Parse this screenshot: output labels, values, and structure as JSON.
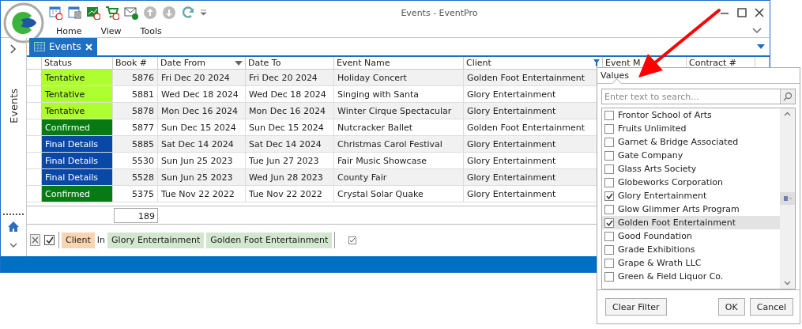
{
  "window": {
    "title": "Events - EventPro",
    "ribbon_tabs": [
      "Home",
      "View",
      "Tools"
    ]
  },
  "nav": {
    "label": "Events"
  },
  "document_tabs": [
    {
      "label": "Events",
      "selected": true
    }
  ],
  "table": {
    "columns": [
      {
        "label": "Status",
        "sorted": false,
        "filtered": false
      },
      {
        "label": "Book #",
        "sorted": false,
        "filtered": false
      },
      {
        "label": "Date From",
        "sorted": true,
        "filtered": false
      },
      {
        "label": "Date To",
        "sorted": false,
        "filtered": false
      },
      {
        "label": "Event Name",
        "sorted": false,
        "filtered": false
      },
      {
        "label": "Client",
        "sorted": false,
        "filtered": true
      },
      {
        "label": "Event M",
        "sorted": false,
        "filtered": false
      },
      {
        "label": "Contract #",
        "sorted": false,
        "filtered": false
      }
    ],
    "rows": [
      {
        "status": "Tentative",
        "color": "#adff2f",
        "book": "5876",
        "date_from": "Fri Dec 20 2024",
        "date_to": "Fri Dec 20 2024",
        "event_name": "Holiday Concert",
        "client": "Golden Foot Entertainment"
      },
      {
        "status": "Tentative",
        "color": "#adff2f",
        "book": "5881",
        "date_from": "Wed Dec 18 2024",
        "date_to": "Wed Dec 18 2024",
        "event_name": "Singing with Santa",
        "client": "Glory Entertainment"
      },
      {
        "status": "Tentative",
        "color": "#adff2f",
        "book": "5878",
        "date_from": "Mon Dec 16 2024",
        "date_to": "Mon Dec 16 2024",
        "event_name": "Winter Cirque Spectacular",
        "client": "Glory Entertainment"
      },
      {
        "status": "Confirmed",
        "color": "#087a14",
        "book": "5877",
        "date_from": "Sun Dec 15 2024",
        "date_to": "Sun Dec 15 2024",
        "event_name": "Nutcracker Ballet",
        "client": "Golden Foot Entertainment"
      },
      {
        "status": "Final Details",
        "color": "#0a48a8",
        "book": "5885",
        "date_from": "Sat Dec 14 2024",
        "date_to": "Sat Dec 14 2024",
        "event_name": "Christmas Carol Festival",
        "client": "Glory Entertainment"
      },
      {
        "status": "Final Details",
        "color": "#0a48a8",
        "book": "5530",
        "date_from": "Sun Jun 25 2023",
        "date_to": "Tue Jun 27 2023",
        "event_name": "Fair Music Showcase",
        "client": "Glory Entertainment"
      },
      {
        "status": "Final Details",
        "color": "#0a48a8",
        "book": "5528",
        "date_from": "Sun Jun 25 2023",
        "date_to": "Wed Jun 28 2023",
        "event_name": "County Fair",
        "client": "Glory Entertainment"
      },
      {
        "status": "Confirmed",
        "color": "#087a14",
        "book": "5375",
        "date_from": "Tue Nov 22 2022",
        "date_to": "Tue Nov 22 2022",
        "event_name": "Crystal Solar Quake",
        "client": "Glory Entertainment"
      }
    ],
    "total": "189"
  },
  "filter": {
    "enabled": true,
    "field": "Client",
    "operator": "In",
    "values": [
      "Glory Entertainment",
      "Golden Foot Entertainment"
    ]
  },
  "filter_popup": {
    "tab": "Values",
    "search_placeholder": "Enter text to search...",
    "items": [
      {
        "label": "Frontor School of Arts",
        "checked": false,
        "selected": false
      },
      {
        "label": "Fruits Unlimited",
        "checked": false,
        "selected": false
      },
      {
        "label": "Garnet & Bridge Associated",
        "checked": false,
        "selected": false
      },
      {
        "label": "Gate Company",
        "checked": false,
        "selected": false
      },
      {
        "label": "Glass Arts Society",
        "checked": false,
        "selected": false
      },
      {
        "label": "Globeworks Corporation",
        "checked": false,
        "selected": false
      },
      {
        "label": "Glory Entertainment",
        "checked": true,
        "selected": false
      },
      {
        "label": "Glow Glimmer Arts Program",
        "checked": false,
        "selected": false
      },
      {
        "label": "Golden Foot Entertainment",
        "checked": true,
        "selected": true
      },
      {
        "label": "Good Foundation",
        "checked": false,
        "selected": false
      },
      {
        "label": "Grade Exhibitions",
        "checked": false,
        "selected": false
      },
      {
        "label": "Grape & Wrath LLC",
        "checked": false,
        "selected": false
      },
      {
        "label": "Green & Field Liquor Co.",
        "checked": false,
        "selected": false
      }
    ],
    "buttons": [
      "Clear Filter",
      "OK",
      "Cancel"
    ]
  }
}
